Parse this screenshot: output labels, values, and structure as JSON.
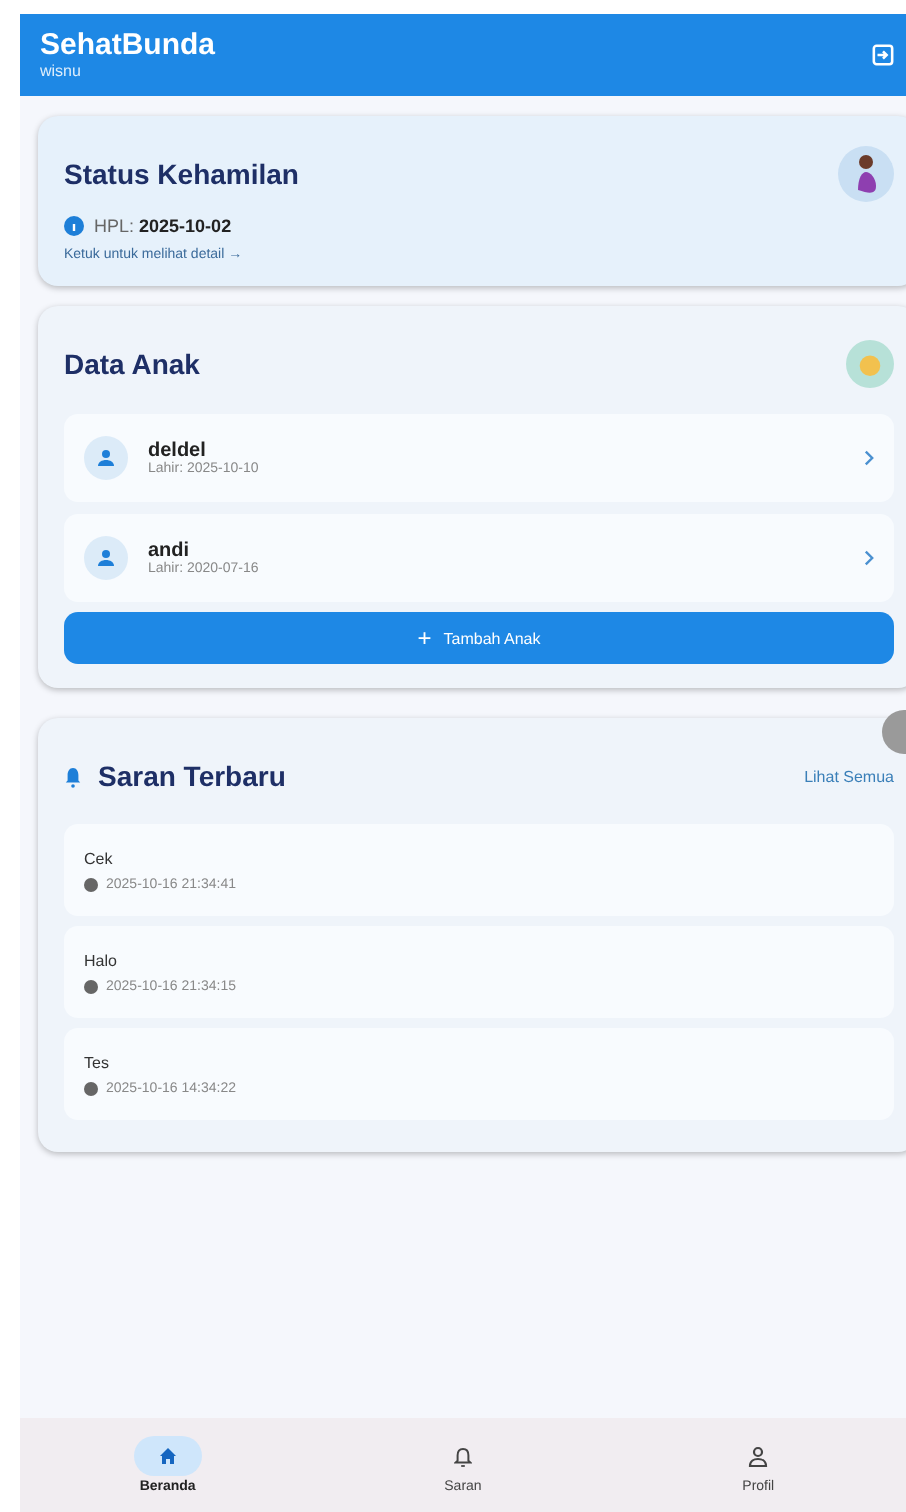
{
  "app_bar": {
    "title": "SehatBunda",
    "subtitle": "wisnu"
  },
  "pregnancy": {
    "title": "Status Kehamilan",
    "hpl_label": "HPL:",
    "hpl_value": "2025-10-02",
    "link": "Ketuk untuk melihat detail →"
  },
  "children": {
    "title": "Data Anak",
    "items": [
      {
        "name": "deldel",
        "birth": "Lahir: 2025-10-10"
      },
      {
        "name": "andi",
        "birth": "Lahir: 2020-07-16"
      }
    ],
    "add_button": {
      "icon": "+",
      "label": "Tambah Anak"
    }
  },
  "suggestions": {
    "title": "Saran Terbaru",
    "see_all": "Lihat Semua",
    "items": [
      {
        "text": "Cek",
        "time": "2025-10-16 21:34:41"
      },
      {
        "text": "Halo",
        "time": "2025-10-16 21:34:15"
      },
      {
        "text": "Tes",
        "time": "2025-10-16 14:34:22"
      }
    ]
  },
  "nav": [
    {
      "kind": "home",
      "label": "Beranda",
      "selected": true
    },
    {
      "kind": "bell",
      "label": "Saran",
      "selected": false
    },
    {
      "kind": "person",
      "label": "Profil",
      "selected": false
    }
  ]
}
